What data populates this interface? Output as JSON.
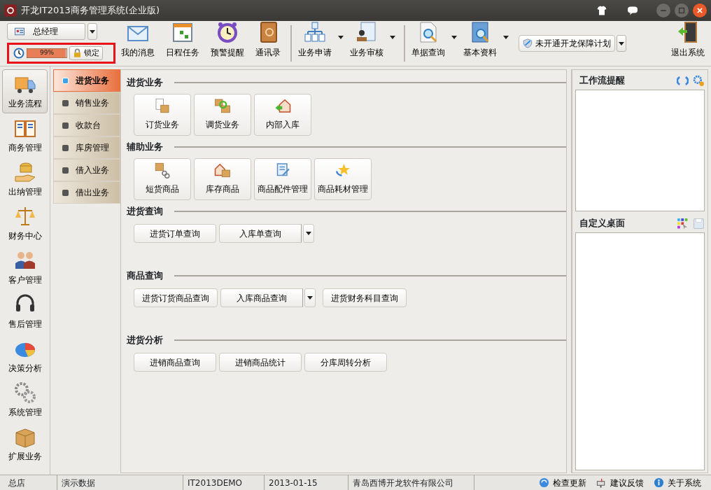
{
  "window": {
    "title": "开龙IT2013商务管理系统(企业版)"
  },
  "role_selector": {
    "label": "总经理"
  },
  "memory": {
    "level": 0.99,
    "reading": "99%"
  },
  "lock_button": {
    "label": "锁定"
  },
  "toolbar_groups": [
    [
      {
        "label": "我的消息",
        "has_menu": false
      },
      {
        "label": "日程任务",
        "has_menu": false
      },
      {
        "label": "预警提醒",
        "has_menu": false
      },
      {
        "label": "通讯录",
        "has_menu": false
      }
    ],
    [
      {
        "label": "业务申请",
        "has_menu": true
      },
      {
        "label": "业务审核",
        "has_menu": true
      }
    ],
    [
      {
        "label": "单据查询",
        "has_menu": true
      },
      {
        "label": "基本资料",
        "has_menu": true
      }
    ]
  ],
  "plan_button": {
    "label": "未开通开龙保障计划"
  },
  "exit_button": {
    "label": "退出系统"
  },
  "nav": [
    {
      "label": "业务流程",
      "selected": true
    },
    {
      "label": "商务管理",
      "selected": false
    },
    {
      "label": "出纳管理",
      "selected": false
    },
    {
      "label": "财务中心",
      "selected": false
    },
    {
      "label": "客户管理",
      "selected": false
    },
    {
      "label": "售后管理",
      "selected": false
    },
    {
      "label": "决策分析",
      "selected": false
    },
    {
      "label": "系统管理",
      "selected": false
    },
    {
      "label": "扩展业务",
      "selected": false
    }
  ],
  "submenu": [
    {
      "label": "进货业务",
      "selected": true
    },
    {
      "label": "销售业务",
      "selected": false
    },
    {
      "label": "收款台",
      "selected": false
    },
    {
      "label": "库房管理",
      "selected": false
    },
    {
      "label": "借入业务",
      "selected": false
    },
    {
      "label": "借出业务",
      "selected": false
    }
  ],
  "sections": [
    {
      "title": "进货业务",
      "kind": "tiles",
      "buttons": [
        {
          "label": "订货业务"
        },
        {
          "label": "调货业务"
        },
        {
          "label": "内部入库"
        }
      ]
    },
    {
      "title": "辅助业务",
      "kind": "tiles",
      "buttons": [
        {
          "label": "短货商品"
        },
        {
          "label": "库存商品"
        },
        {
          "label": "商品配件管理"
        },
        {
          "label": "商品耗材管理"
        }
      ]
    },
    {
      "title": "进货查询",
      "kind": "buttons",
      "buttons": [
        {
          "label": "进货订单查询",
          "has_menu": false
        },
        {
          "label": "入库单查询",
          "has_menu": true
        }
      ]
    },
    {
      "title": "商品查询",
      "kind": "buttons",
      "buttons": [
        {
          "label": "进货订货商品查询",
          "has_menu": false
        },
        {
          "label": "入库商品查询",
          "has_menu": true
        },
        {
          "label": "进货财务科目查询",
          "has_menu": false
        }
      ]
    },
    {
      "title": "进货分析",
      "kind": "buttons",
      "buttons": [
        {
          "label": "进销商品查询",
          "has_menu": false
        },
        {
          "label": "进销商品统计",
          "has_menu": false
        },
        {
          "label": "分库周转分析",
          "has_menu": false
        }
      ]
    }
  ],
  "right_panels": [
    {
      "title": "工作流提醒"
    },
    {
      "title": "自定义桌面"
    }
  ],
  "status_bar": {
    "fields": [
      "总店",
      "演示数据",
      "IT2013DEMO",
      "2013-01-15",
      "青岛西博开龙软件有限公司"
    ],
    "links": [
      {
        "label": "检查更新"
      },
      {
        "label": "建议反馈"
      },
      {
        "label": "关于系统"
      }
    ]
  }
}
